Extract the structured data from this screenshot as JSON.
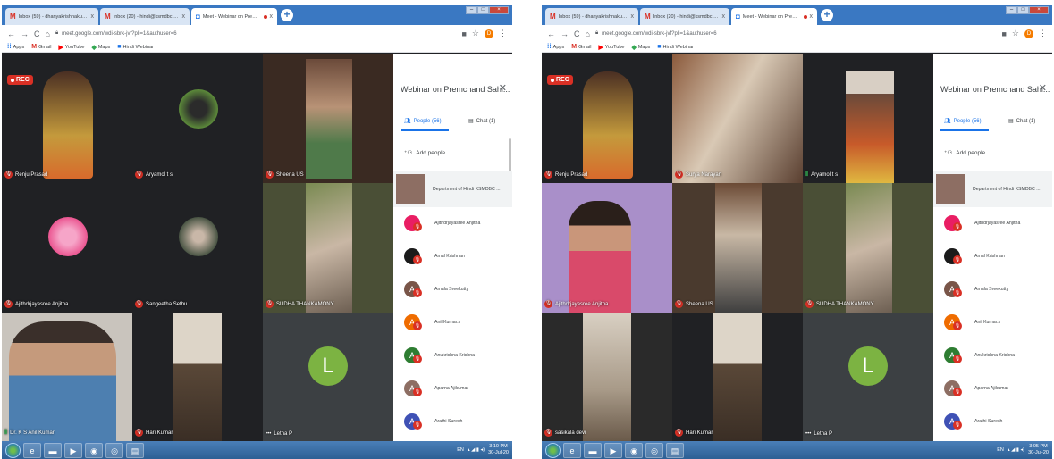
{
  "screens": [
    {
      "browser": {
        "tabs": [
          {
            "title": "Inbox (59) - dhanyakrishnakumar",
            "icon": "gmail-icon",
            "close": "x"
          },
          {
            "title": "Inbox (20) - hindi@ksmdbc.ac.in",
            "icon": "gmail-icon",
            "close": "x"
          },
          {
            "title": "Meet - Webinar on Premcha",
            "icon": "meet-icon",
            "close": "x"
          }
        ],
        "new_tab": "+",
        "url": "meet.google.com/wdi-sbrk-jvf?pli=1&authuser=6",
        "profile_initial": "D",
        "bookmarks": [
          "Apps",
          "Gmail",
          "YouTube",
          "Maps",
          "Hindi Webinar"
        ]
      },
      "rec_label": "REC",
      "tiles": [
        {
          "name": "Renju Prasad",
          "mic": "muted"
        },
        {
          "name": "Aryamol t s",
          "mic": "muted"
        },
        {
          "name": "Sheena US",
          "mic": "muted"
        },
        {
          "name": "Ajithdrjayasree Anjitha",
          "mic": "muted"
        },
        {
          "name": "Sangeetha Sethu",
          "mic": "muted"
        },
        {
          "name": "SUDHA THANKAMONY",
          "mic": "muted"
        },
        {
          "name": "Dr. K S Anil Kumar",
          "mic": "speaking"
        },
        {
          "name": "Hari Kumar",
          "mic": "muted"
        },
        {
          "name": "Letha P",
          "mic": "idle",
          "letter": "L"
        }
      ],
      "panel": {
        "title": "Webinar on Premchand Sahi...",
        "people_tab": "People (56)",
        "chat_tab": "Chat (1)",
        "add_people": "Add people",
        "presenter": "Department of Hindi KSMDBC ...",
        "people": [
          {
            "name": "Ajithdrjayasree Anjitha",
            "initial": "",
            "color": "#e91e63"
          },
          {
            "name": "Amal Krishnan",
            "initial": "",
            "color": "#1b1b1b"
          },
          {
            "name": "Amala Sreekutty",
            "initial": "A",
            "color": "#795548"
          },
          {
            "name": "Anil Kumar.s",
            "initial": "A",
            "color": "#ef6c00"
          },
          {
            "name": "Anukrishna Krishna",
            "initial": "A",
            "color": "#2e7d32"
          },
          {
            "name": "Aparna Ajikumar",
            "initial": "A",
            "color": "#8d6e63"
          },
          {
            "name": "Arathi Suresh",
            "initial": "A",
            "color": "#3f51b5"
          }
        ]
      },
      "taskbar": {
        "lang": "EN",
        "time": "3:10 PM",
        "date": "30-Jul-20"
      }
    },
    {
      "browser": {
        "tabs": [
          {
            "title": "Inbox (59) - dhanyakrishnakumar",
            "icon": "gmail-icon",
            "close": "x"
          },
          {
            "title": "Inbox (20) - hindi@ksmdbc.ac.in",
            "icon": "gmail-icon",
            "close": "x"
          },
          {
            "title": "Meet - Webinar on Premcha",
            "icon": "meet-icon",
            "close": "x"
          }
        ],
        "new_tab": "+",
        "url": "meet.google.com/wdi-sbrk-jvf?pli=1&authuser=6",
        "profile_initial": "D",
        "bookmarks": [
          "Apps",
          "Gmail",
          "YouTube",
          "Maps",
          "Hindi Webinar"
        ]
      },
      "rec_label": "REC",
      "tiles": [
        {
          "name": "Renju Prasad",
          "mic": "muted"
        },
        {
          "name": "Surya Narayan",
          "mic": "muted"
        },
        {
          "name": "Aryamol t s",
          "mic": "speaking"
        },
        {
          "name": "Ajithdrjayasree Anjitha",
          "mic": "muted"
        },
        {
          "name": "Sheena US",
          "mic": "muted"
        },
        {
          "name": "SUDHA THANKAMONY",
          "mic": "muted"
        },
        {
          "name": "sasikala devi",
          "mic": "muted"
        },
        {
          "name": "Hari Kumar",
          "mic": "muted"
        },
        {
          "name": "Letha P",
          "mic": "idle",
          "letter": "L"
        }
      ],
      "panel": {
        "title": "Webinar on Premchand Sahi...",
        "people_tab": "People (56)",
        "chat_tab": "Chat (1)",
        "add_people": "Add people",
        "presenter": "Department of Hindi KSMDBC ...",
        "people": [
          {
            "name": "Ajithdrjayasree Anjitha",
            "initial": "",
            "color": "#e91e63"
          },
          {
            "name": "Amal Krishnan",
            "initial": "",
            "color": "#1b1b1b"
          },
          {
            "name": "Amala Sreekutty",
            "initial": "A",
            "color": "#795548"
          },
          {
            "name": "Anil Kumar.s",
            "initial": "A",
            "color": "#ef6c00"
          },
          {
            "name": "Anukrishna Krishna",
            "initial": "A",
            "color": "#2e7d32"
          },
          {
            "name": "Aparna Ajikumar",
            "initial": "A",
            "color": "#8d6e63"
          },
          {
            "name": "Arathi Suresh",
            "initial": "A",
            "color": "#3f51b5"
          }
        ]
      },
      "taskbar": {
        "lang": "EN",
        "time": "3:05 PM",
        "date": "30-Jul-20"
      }
    }
  ]
}
